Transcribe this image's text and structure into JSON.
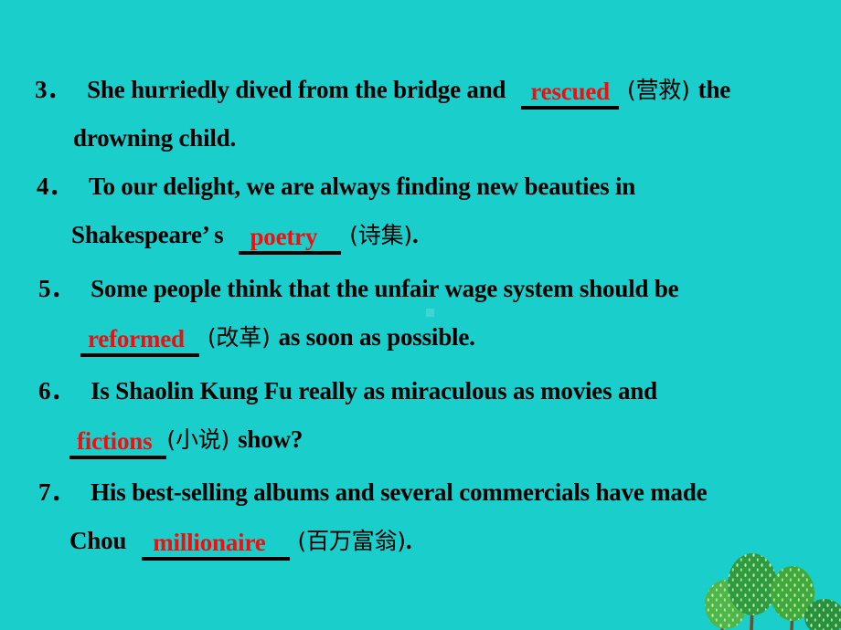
{
  "slide": {
    "background_color": "#1ACFCB",
    "text_color": "#000000",
    "answer_color": "#F40D0D",
    "underline_color": "#000000"
  },
  "questions": [
    {
      "number": "3．",
      "line1_before": "She hurriedly dived from the bridge and",
      "answer": "rescued",
      "line1_after_cn": "(营救)",
      "line1_after": "the",
      "line2": "drowning child."
    },
    {
      "number": "4．",
      "line1": "To our delight, we are always finding new beauties in",
      "line2_before": "Shakespeare’ s",
      "answer": "poetry",
      "line2_cn": "(诗集)",
      "line2_after": "."
    },
    {
      "number": "5．",
      "line1": "Some people think that the unfair wage system should be",
      "answer": "reformed",
      "line2_cn": "(改革)",
      "line2_after": "as soon as possible."
    },
    {
      "number": "6．",
      "line1": "Is Shaolin Kung Fu really as miraculous as movies and",
      "answer": "fictions",
      "line2_cn": "(小说)",
      "line2_after": "show?"
    },
    {
      "number": "7．",
      "line1": "His best-selling albums and several commercials have made",
      "line2_before": "Chou",
      "answer": "millionaire",
      "line2_cn": "(百万富翁)",
      "line2_after": "."
    }
  ],
  "decoration": {
    "name": "trees-illustration",
    "tree_foliage_colors": [
      "#3FA93A",
      "#2E9B3F",
      "#4FB648",
      "#27913C"
    ],
    "trunk_color": "#7A4A24",
    "speckle_color": "#CFEFC4"
  }
}
